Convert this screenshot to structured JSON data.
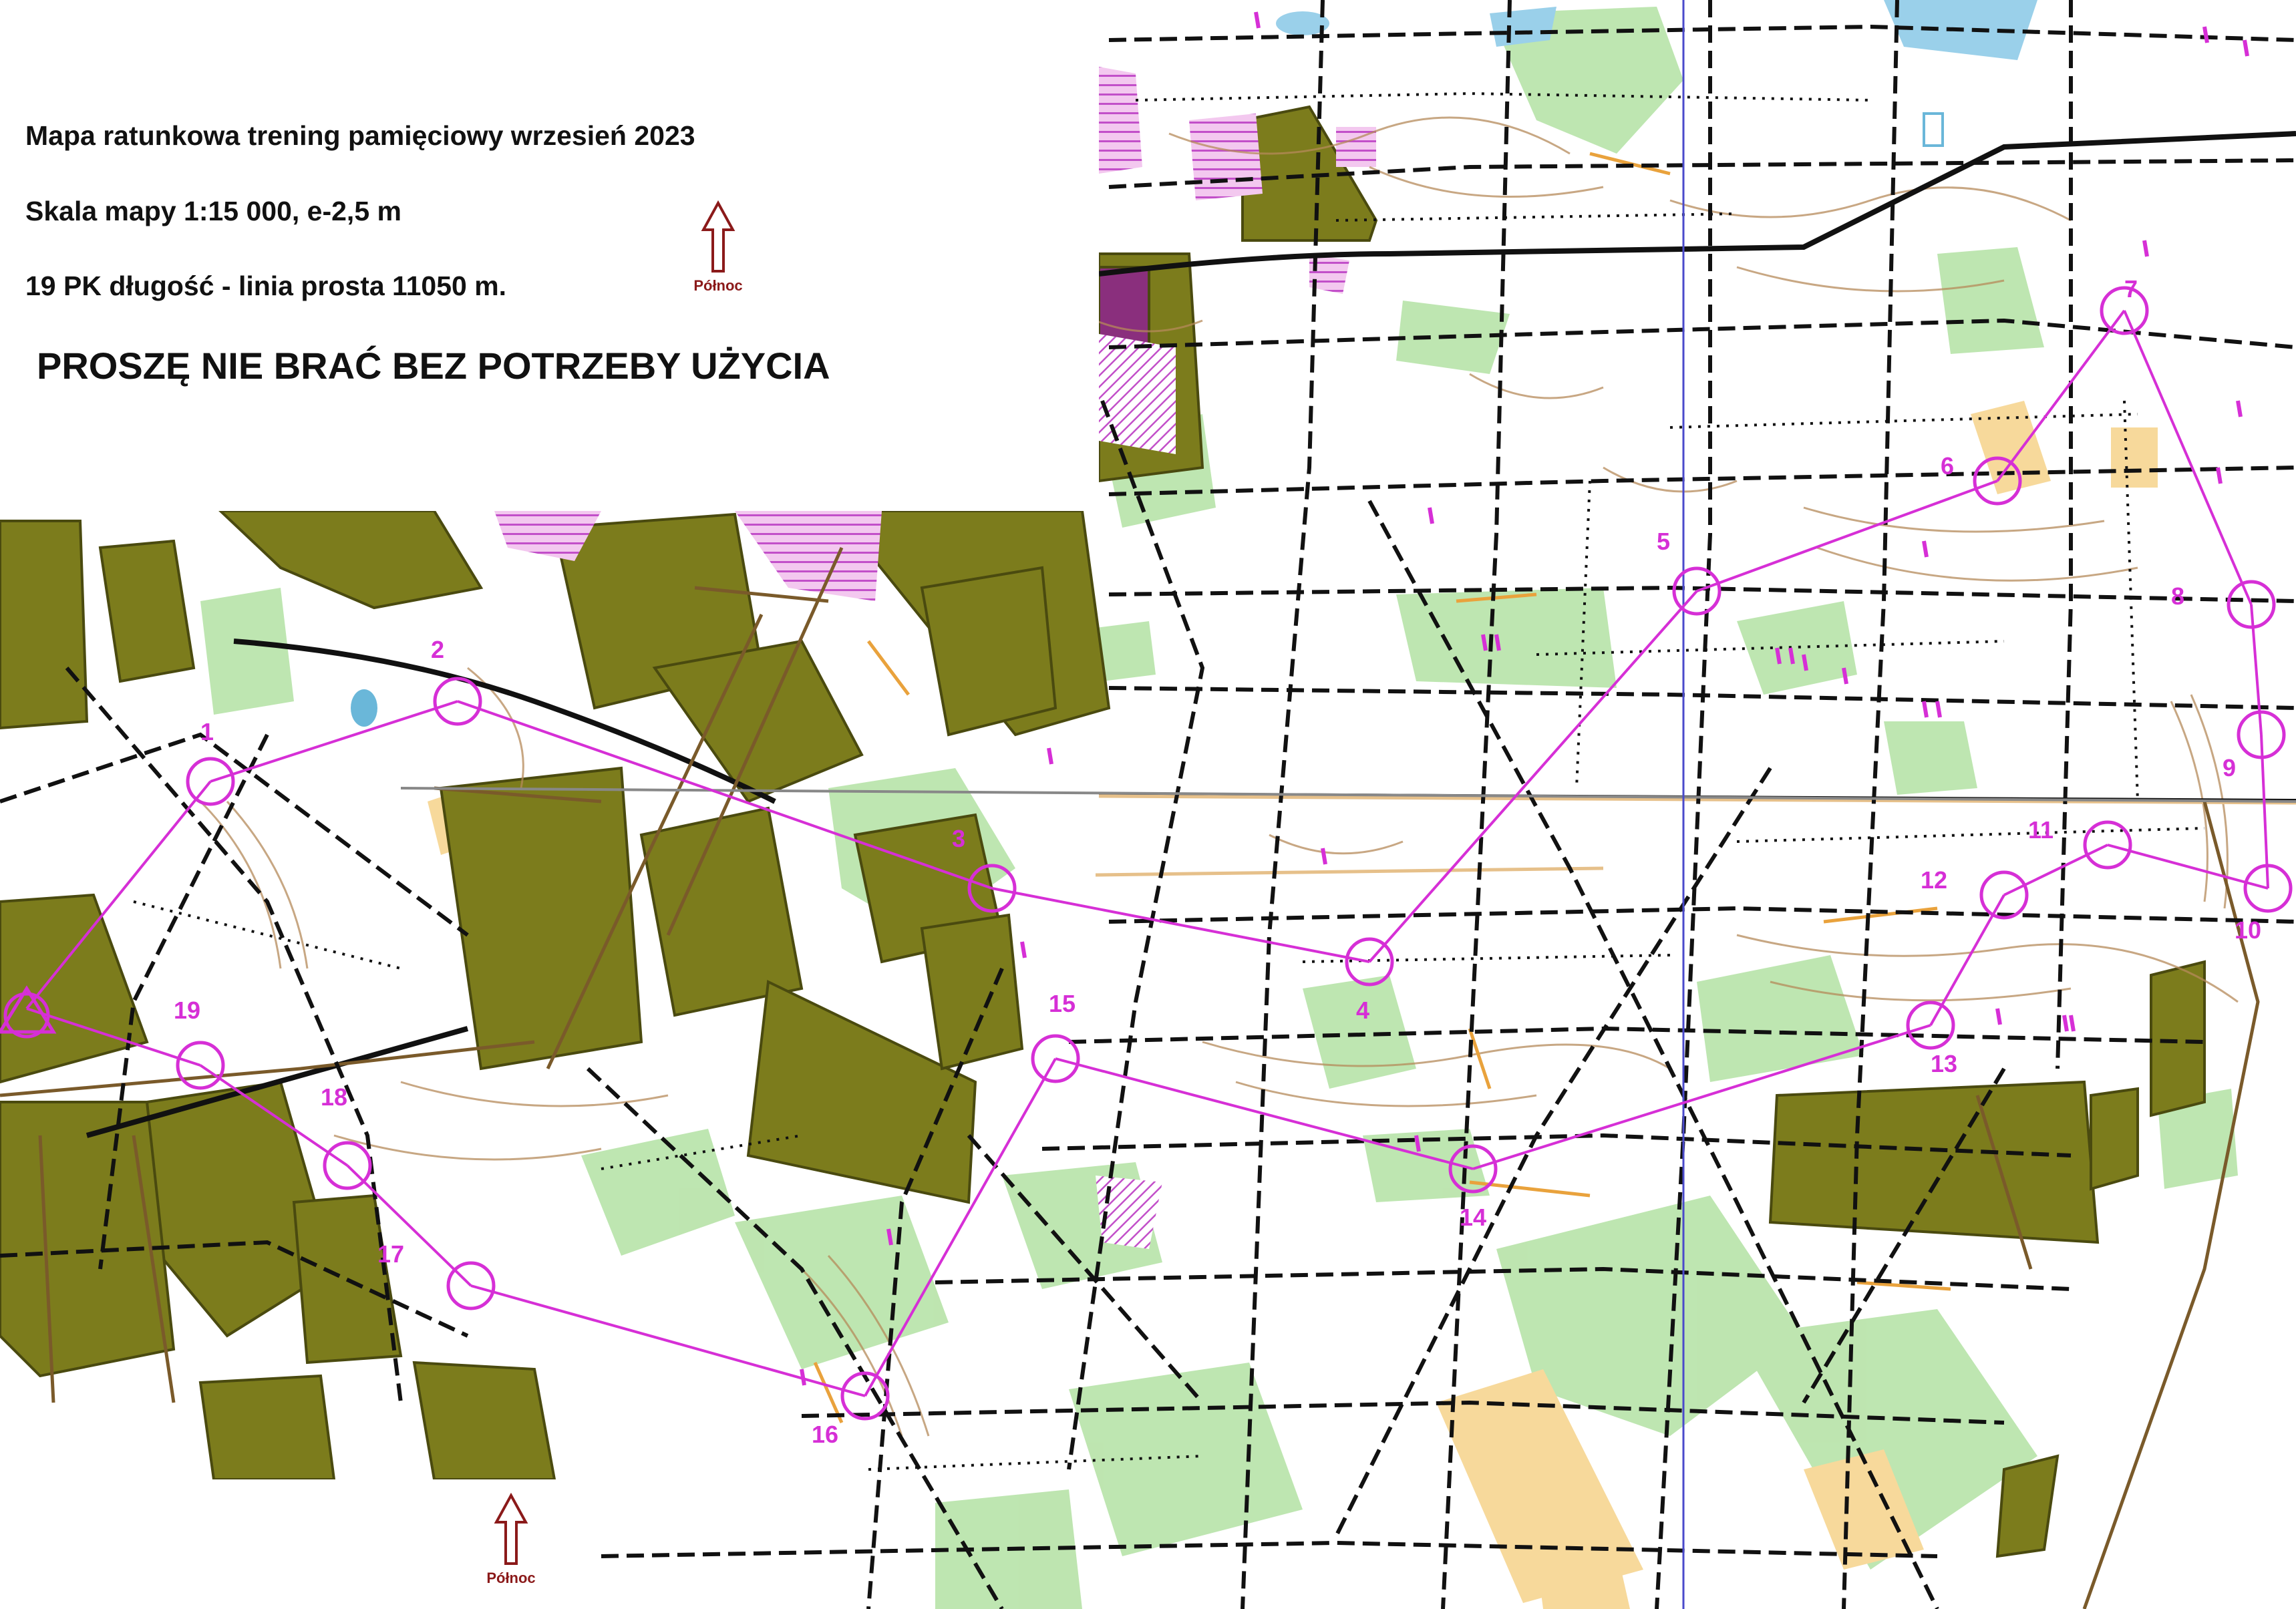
{
  "header": {
    "title": "Mapa ratunkowa trening pamięciowy wrzesień 2023",
    "scale": "Skala mapy 1:15 000, e-2,5 m",
    "course": "19 PK długość - linia prosta 11050 m.",
    "warning": "PROSZĘ NIE BRAĆ BEZ POTRZEBY UŻYCIA"
  },
  "north_labels": [
    "Północ",
    "Północ"
  ],
  "colors": {
    "course": "#d62fd6",
    "forest_dark": "#7c7c1c",
    "open_green": "#b7e3a8",
    "open_yellow": "#f7d99b",
    "contour": "#b58a5a",
    "track": "#111111",
    "restricted": "#c24fc9",
    "water": "#6ab7d9",
    "north_arrow": "#8b1a1a"
  },
  "controls": [
    {
      "number": "1"
    },
    {
      "number": "2"
    },
    {
      "number": "3"
    },
    {
      "number": "4"
    },
    {
      "number": "5"
    },
    {
      "number": "6"
    },
    {
      "number": "7"
    },
    {
      "number": "8"
    },
    {
      "number": "9"
    },
    {
      "number": "10"
    },
    {
      "number": "11"
    },
    {
      "number": "12"
    },
    {
      "number": "13"
    },
    {
      "number": "14"
    },
    {
      "number": "15"
    },
    {
      "number": "16"
    },
    {
      "number": "17"
    },
    {
      "number": "18"
    },
    {
      "number": "19"
    }
  ]
}
